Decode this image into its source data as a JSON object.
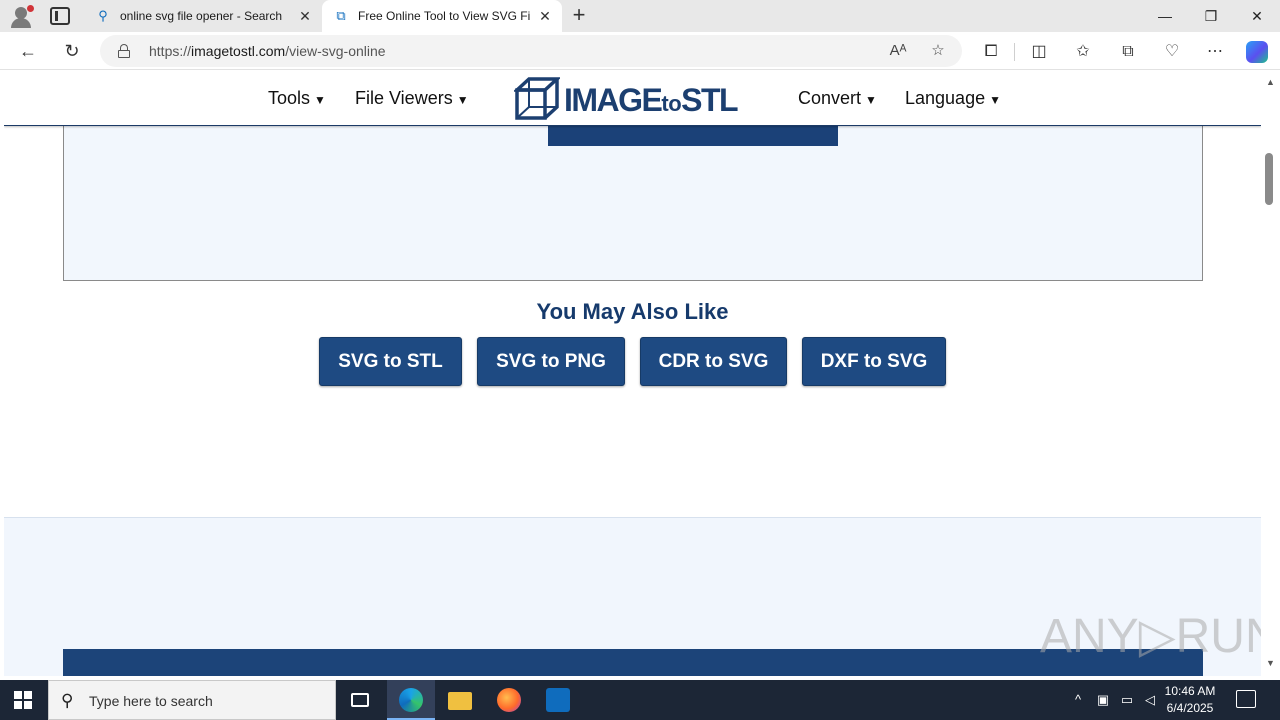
{
  "browser": {
    "tabs": [
      {
        "title": "online svg file opener - Search",
        "icon": "search-icon"
      },
      {
        "title": "Free Online Tool to View SVG File",
        "icon": "site-favicon-icon"
      }
    ],
    "window_controls": {
      "minimize": "—",
      "restore": "❐",
      "close": "✕"
    },
    "address": {
      "protocol": "https://",
      "host": "imagetostl.com",
      "path": "/view-svg-online"
    }
  },
  "page": {
    "nav": {
      "left": [
        {
          "label": "Tools"
        },
        {
          "label": "File Viewers"
        }
      ],
      "right": [
        {
          "label": "Convert"
        },
        {
          "label": "Language"
        }
      ],
      "arrow": "▼",
      "logo": {
        "main": "IMAGE",
        "mid": "to",
        "end": "STL"
      }
    },
    "also_like": {
      "title": "You May Also Like",
      "buttons": [
        "SVG to STL",
        "SVG to PNG",
        "CDR to SVG",
        "DXF to SVG"
      ]
    },
    "watermark": "ANY▷RUN"
  },
  "taskbar": {
    "search_placeholder": "Type here to search",
    "time": "10:46 AM",
    "date": "6/4/2025"
  },
  "colors": {
    "brand_blue": "#1c3f70",
    "button_blue": "#1e4a82",
    "taskbar": "#1c2636"
  }
}
